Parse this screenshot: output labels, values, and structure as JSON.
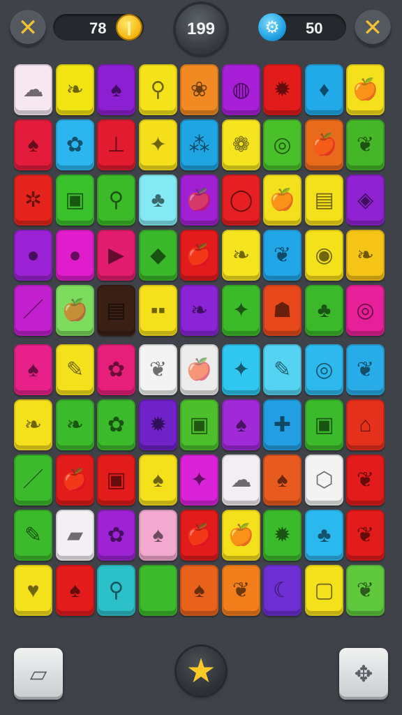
{
  "hud": {
    "close_left_icon": "✕",
    "coins": "78",
    "coin_icon": "coin-icon",
    "coin_glyph": "❙",
    "level": "199",
    "gems": "50",
    "gear_icon": "⚙",
    "close_right_icon": "✕"
  },
  "board": {
    "rows": [
      [
        {
          "color": "#f7e7f0",
          "icon": "☁"
        },
        {
          "color": "#f2e312",
          "icon": "❧"
        },
        {
          "color": "#8c1fd1",
          "icon": "♠"
        },
        {
          "color": "#f4e21a",
          "icon": "⚲"
        },
        {
          "color": "#f18a22",
          "icon": "❀"
        },
        {
          "color": "#a720d8",
          "icon": "◍"
        },
        {
          "color": "#e21b1b",
          "icon": "✹"
        },
        {
          "color": "#22a9e8",
          "icon": "♦"
        },
        {
          "color": "#f5e01c",
          "icon": "🍎"
        }
      ],
      [
        {
          "color": "#e41c3c",
          "icon": "♠"
        },
        {
          "color": "#2cb6f0",
          "icon": "✿"
        },
        {
          "color": "#e21b30",
          "icon": "⊥"
        },
        {
          "color": "#f5df1a",
          "icon": "✦"
        },
        {
          "color": "#1fa5e2",
          "icon": "⁂"
        },
        {
          "color": "#f5e41e",
          "icon": "❁"
        },
        {
          "color": "#49c02a",
          "icon": "◎"
        },
        {
          "color": "#e86a1b",
          "icon": "🍎"
        },
        {
          "color": "#46b629",
          "icon": "❦"
        }
      ],
      [
        {
          "color": "#e5251d",
          "icon": "✲"
        },
        {
          "color": "#3ac12c",
          "icon": "▣"
        },
        {
          "color": "#3cba29",
          "icon": "⚲"
        },
        {
          "color": "#84e9f2",
          "icon": "♣"
        },
        {
          "color": "#a220d3",
          "icon": "🍎"
        },
        {
          "color": "#e51f22",
          "icon": "◯"
        },
        {
          "color": "#f4e01c",
          "icon": "🍎"
        },
        {
          "color": "#f5e01c",
          "icon": "▤"
        },
        {
          "color": "#8e22d0",
          "icon": "◈"
        }
      ],
      [
        {
          "color": "#9b22d4",
          "icon": "●"
        },
        {
          "color": "#e01ccc",
          "icon": "●"
        },
        {
          "color": "#e21c6e",
          "icon": "▶"
        },
        {
          "color": "#3ab72a",
          "icon": "◆"
        },
        {
          "color": "#e31b1b",
          "icon": "🍎"
        },
        {
          "color": "#f5e41e",
          "icon": "❧"
        },
        {
          "color": "#21a7e8",
          "icon": "❦"
        },
        {
          "color": "#f5e01c",
          "icon": "◉"
        },
        {
          "color": "#f6c416",
          "icon": "❧"
        }
      ],
      [
        {
          "color": "#c21fce",
          "icon": "／"
        },
        {
          "color": "#7ddc5e",
          "icon": "🍎"
        },
        {
          "color": "#3a1f14",
          "icon": "▤"
        },
        {
          "color": "#f5e01c",
          "icon": "▪▪"
        },
        {
          "color": "#8a24d6",
          "icon": "❧"
        },
        {
          "color": "#3cbb2a",
          "icon": "✦"
        },
        {
          "color": "#e6481c",
          "icon": "☗"
        },
        {
          "color": "#3bb92b",
          "icon": "♣"
        },
        {
          "color": "#e7209a",
          "icon": "◎"
        }
      ],
      [
        {
          "color": "#e8208a",
          "icon": "♠"
        },
        {
          "color": "#f5e01c",
          "icon": "✎"
        },
        {
          "color": "#e61f7a",
          "icon": "✿"
        },
        {
          "color": "#f3f3f3",
          "icon": "❦"
        },
        {
          "color": "#ececec",
          "icon": "🍎"
        },
        {
          "color": "#2fc6f0",
          "icon": "✦"
        },
        {
          "color": "#54d4f2",
          "icon": "✎"
        },
        {
          "color": "#2eb9ee",
          "icon": "◎"
        },
        {
          "color": "#28ace8",
          "icon": "❦"
        }
      ],
      [
        {
          "color": "#f5e01c",
          "icon": "❧"
        },
        {
          "color": "#3bba2b",
          "icon": "❧"
        },
        {
          "color": "#3bba2b",
          "icon": "✿"
        },
        {
          "color": "#6e22c8",
          "icon": "✹"
        },
        {
          "color": "#4bc02c",
          "icon": "▣"
        },
        {
          "color": "#a02ad8",
          "icon": "♠"
        },
        {
          "color": "#229fe2",
          "icon": "✚"
        },
        {
          "color": "#3bba2b",
          "icon": "▣"
        },
        {
          "color": "#e5301c",
          "icon": "⌂"
        }
      ],
      [
        {
          "color": "#3bba2b",
          "icon": "／"
        },
        {
          "color": "#e21b1b",
          "icon": "🍎"
        },
        {
          "color": "#e21b1b",
          "icon": "▣"
        },
        {
          "color": "#f5e01c",
          "icon": "♠"
        },
        {
          "color": "#da22d8",
          "icon": "✦"
        },
        {
          "color": "#f3eef3",
          "icon": "☁"
        },
        {
          "color": "#e85a1d",
          "icon": "♠"
        },
        {
          "color": "#f3f3f3",
          "icon": "⬡"
        },
        {
          "color": "#e31b1b",
          "icon": "❦"
        }
      ],
      [
        {
          "color": "#3bba2b",
          "icon": "✎"
        },
        {
          "color": "#f3f0f3",
          "icon": "▰"
        },
        {
          "color": "#9d23d5",
          "icon": "✿"
        },
        {
          "color": "#f3a8cf",
          "icon": "♠"
        },
        {
          "color": "#e31b1b",
          "icon": "🍎"
        },
        {
          "color": "#f5e01c",
          "icon": "🍎"
        },
        {
          "color": "#3bba2b",
          "icon": "✹"
        },
        {
          "color": "#2bb8ee",
          "icon": "♣"
        },
        {
          "color": "#e31b1b",
          "icon": "❦"
        }
      ],
      [
        {
          "color": "#f5e01c",
          "icon": "♥"
        },
        {
          "color": "#e31b1b",
          "icon": "♠"
        },
        {
          "color": "#2cc0c9",
          "icon": "⚲"
        },
        {
          "color": "#3bba2b",
          "icon": ""
        },
        {
          "color": "#e8621c",
          "icon": "♠"
        },
        {
          "color": "#f27e1b",
          "icon": "❦"
        },
        {
          "color": "#6d2fd2",
          "icon": "☾"
        },
        {
          "color": "#f5e01c",
          "icon": "▢"
        },
        {
          "color": "#5fc83c",
          "icon": "❦"
        }
      ]
    ]
  },
  "bottom": {
    "left_icon": "▱",
    "center_icon": "★",
    "right_icon": "✥"
  }
}
